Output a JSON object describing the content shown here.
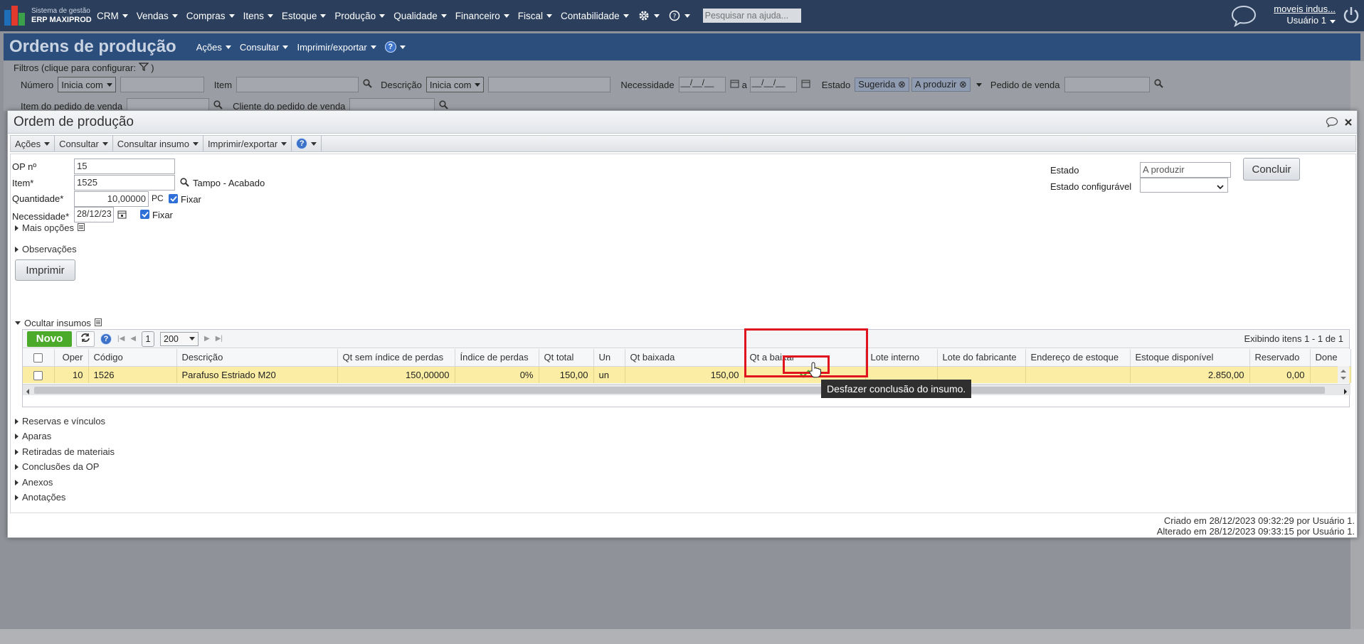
{
  "topbar": {
    "logo_line1": "Sistema de gestão",
    "logo_line2": "ERP MAXIPROD",
    "menu": [
      "CRM",
      "Vendas",
      "Compras",
      "Itens",
      "Estoque",
      "Produção",
      "Qualidade",
      "Financeiro",
      "Fiscal",
      "Contabilidade"
    ],
    "search_placeholder": "Pesquisar na ajuda...",
    "company": "moveis indus...",
    "user": "Usuário 1"
  },
  "page": {
    "title": "Ordens de produção",
    "menu": [
      "Ações",
      "Consultar",
      "Imprimir/exportar"
    ],
    "help": "?"
  },
  "filters": {
    "title": "Filtros (clique para configurar:",
    "numero_label": "Número",
    "numero_mode": "Inicia com",
    "item_label": "Item",
    "descricao_label": "Descrição",
    "descricao_mode": "Inicia com",
    "necessidade_label": "Necessidade",
    "date_from": "__/__/__",
    "date_sep": "a",
    "date_to": "__/__/__",
    "estado_label": "Estado",
    "estado_chips": [
      "Sugerida",
      "A produzir"
    ],
    "pedido_label": "Pedido de venda",
    "item_pedido_label": "Item do pedido de venda",
    "cliente_label": "Cliente do pedido de venda"
  },
  "modal": {
    "title": "Ordem de produção",
    "toolbar": [
      "Ações",
      "Consultar",
      "Consultar insumo",
      "Imprimir/exportar"
    ],
    "help": "?",
    "op_label": "OP nº",
    "op_value": "15",
    "item_label": "Item*",
    "item_value": "1525",
    "item_desc": "Tampo - Acabado",
    "qty_label": "Quantidade*",
    "qty_value": "10,00000",
    "qty_unit": "PC",
    "fixar": "Fixar",
    "need_label": "Necessidade*",
    "need_value": "28/12/23",
    "mais_opcoes": "Mais opções",
    "observacoes": "Observações",
    "imprimir": "Imprimir",
    "estado_label": "Estado",
    "estado_value": "A produzir",
    "estado_conf_label": "Estado configurável",
    "concluir": "Concluir",
    "ocultar_insumos": "Ocultar insumos",
    "sections": [
      "Reservas e vínculos",
      "Aparas",
      "Retiradas de materiais",
      "Conclusões da OP",
      "Anexos",
      "Anotações"
    ],
    "created": "Criado em 28/12/2023 09:32:29 por Usuário 1.",
    "altered": "Alterado em 28/12/2023 09:33:15 por Usuário 1."
  },
  "grid": {
    "novo": "Novo",
    "page": "1",
    "page_size": "200",
    "showing": "Exibindo itens 1 - 1 de 1",
    "columns": [
      "Oper",
      "Código",
      "Descrição",
      "Qt sem índice de perdas",
      "Índice de perdas",
      "Qt total",
      "Un",
      "Qt baixada",
      "Qt a baixar",
      "Lote interno",
      "Lote do fabricante",
      "Endereço de estoque",
      "Estoque disponível",
      "Reservado",
      "Done"
    ],
    "row": {
      "oper": "10",
      "codigo": "1526",
      "descricao": "Parafuso Estriado M20",
      "qt_sem": "150,00000",
      "indice": "0%",
      "qt_total": "150,00",
      "un": "un",
      "qt_baixada": "150,00",
      "estoque": "2.850,00",
      "reservado": "0,00"
    }
  },
  "tooltip": "Desfazer conclusão do insumo.",
  "colors": {
    "accent": "#2b4e7d",
    "highlight": "#e0141e",
    "row": "#fbeea4",
    "novo": "#4caa2a"
  }
}
